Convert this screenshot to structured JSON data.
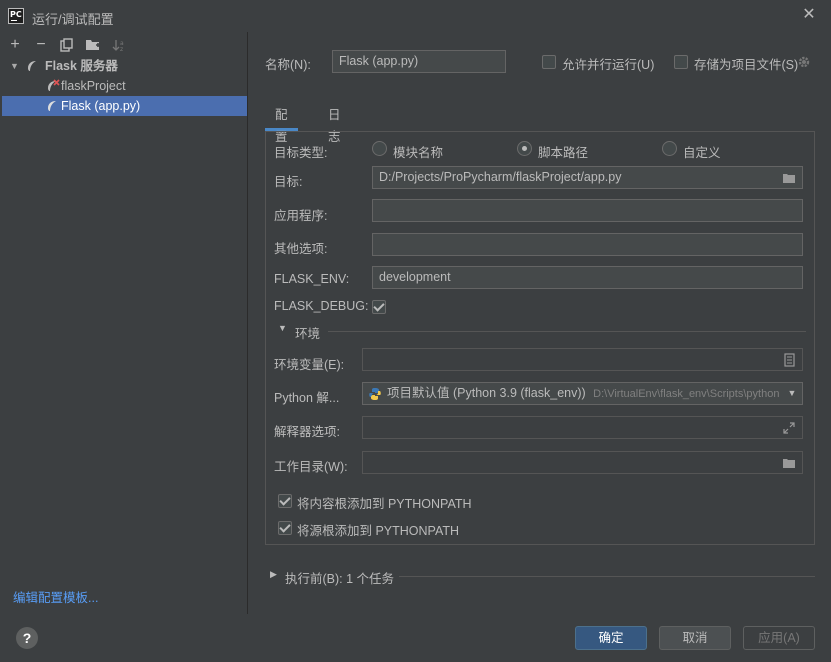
{
  "window": {
    "title": "运行/调试配置"
  },
  "toolbar": {
    "add": "+",
    "remove": "−"
  },
  "tree": {
    "group_label": "Flask 服务器",
    "items": [
      {
        "label": "flaskProject"
      },
      {
        "label": "Flask (app.py)"
      }
    ]
  },
  "sidebar": {
    "edit_templates": "编辑配置模板..."
  },
  "header": {
    "name_label": "名称(N):",
    "name_value": "Flask (app.py)",
    "allow_parallel": "允许并行运行(U)",
    "store_as_file": "存储为项目文件(S)"
  },
  "tabs": [
    {
      "label": "配置"
    },
    {
      "label": "日志"
    }
  ],
  "config": {
    "target_type_label": "目标类型:",
    "target_options": [
      {
        "label": "模块名称",
        "selected": false
      },
      {
        "label": "脚本路径",
        "selected": true
      },
      {
        "label": "自定义",
        "selected": false
      }
    ],
    "target_label": "目标:",
    "target_value": "D:/Projects/ProPycharm/flaskProject/app.py",
    "app_label": "应用程序:",
    "app_value": "",
    "other_options_label": "其他选项:",
    "other_options_value": "",
    "flask_env_label": "FLASK_ENV:",
    "flask_env_value": "development",
    "flask_debug_label": "FLASK_DEBUG:",
    "flask_debug_checked": true,
    "env_section": "环境",
    "env_vars_label": "环境变量(E):",
    "env_vars_value": "",
    "python_interp_label": "Python 解...",
    "python_interp_value": "项目默认值 (Python 3.9 (flask_env))",
    "python_interp_path": "D:\\VirtualEnv\\flask_env\\Scripts\\python",
    "interp_options_label": "解释器选项:",
    "interp_options_value": "",
    "workdir_label": "工作目录(W):",
    "workdir_value": "",
    "add_content_roots": "将内容根添加到 PYTHONPATH",
    "add_source_roots": "将源根添加到 PYTHONPATH"
  },
  "before_launch": {
    "label": "执行前(B): 1 个任务"
  },
  "footer": {
    "help": "?",
    "ok": "确定",
    "cancel": "取消",
    "apply": "应用(A)"
  },
  "colors": {
    "accent": "#4b6eaf",
    "primary_button": "#365880",
    "link": "#589df6",
    "tab_underline": "#4a88c7"
  }
}
